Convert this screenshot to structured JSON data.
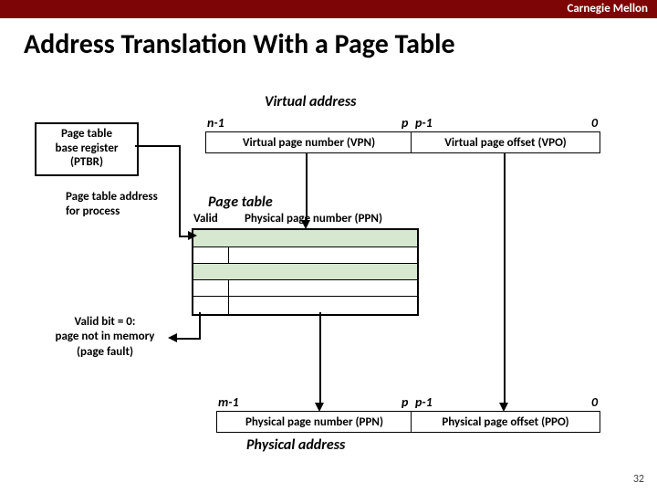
{
  "brand": "Carnegie Mellon",
  "title": "Address Translation With a Page Table",
  "virtual_address_label": "Virtual address",
  "physical_address_label": "Physical address",
  "bit_labels": {
    "n_minus_1": "n-1",
    "p": "p",
    "p_minus_1": "p-1",
    "zero": "0",
    "m_minus_1": "m-1"
  },
  "fields": {
    "vpn": "Virtual page number (VPN)",
    "vpo": "Virtual page offset (VPO)",
    "ppn_upper": "Physical page number (PPN)",
    "ppn_lower": "Physical page number (PPN)",
    "ppo": "Physical page offset (PPO)"
  },
  "ptbr": {
    "line1": "Page table",
    "line2": "base register",
    "line3": "(PTBR)"
  },
  "pt_address_label": {
    "line1": "Page table address",
    "line2": "for process"
  },
  "page_table_heading": "Page table",
  "page_table_cols": {
    "valid": "Valid",
    "ppn": "Physical page number (PPN)"
  },
  "valid_bit_note": {
    "line1": "Valid bit = 0:",
    "line2": "page not in memory",
    "line3": "(page fault)"
  },
  "page_number": "32"
}
